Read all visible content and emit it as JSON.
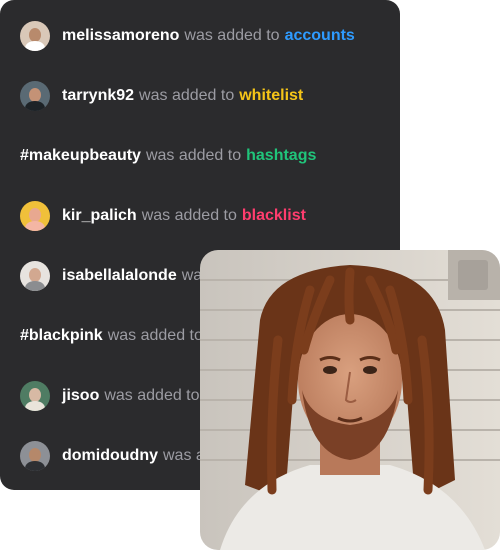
{
  "feed": {
    "verb": "was added to",
    "rows": [
      {
        "handle": "melissamoreno",
        "list": "accounts",
        "list_color": "#2e9bff",
        "avatar": true
      },
      {
        "handle": "tarrynk92",
        "list": "whitelist",
        "list_color": "#f5c518",
        "avatar": true
      },
      {
        "handle": "#makeupbeauty",
        "list": "hashtags",
        "list_color": "#20c47a",
        "avatar": false
      },
      {
        "handle": "kir_palich",
        "list": "blacklist",
        "list_color": "#ff3d6e",
        "avatar": true
      },
      {
        "handle": "isabellalalonde",
        "list": "",
        "list_color": "",
        "avatar": true
      },
      {
        "handle": "#blackpink",
        "list": "",
        "list_color": "",
        "avatar": false
      },
      {
        "handle": "jisoo",
        "list": "",
        "list_color": "",
        "avatar": true
      },
      {
        "handle": "domidoudny",
        "list": "",
        "list_color": "",
        "avatar": true
      }
    ]
  }
}
